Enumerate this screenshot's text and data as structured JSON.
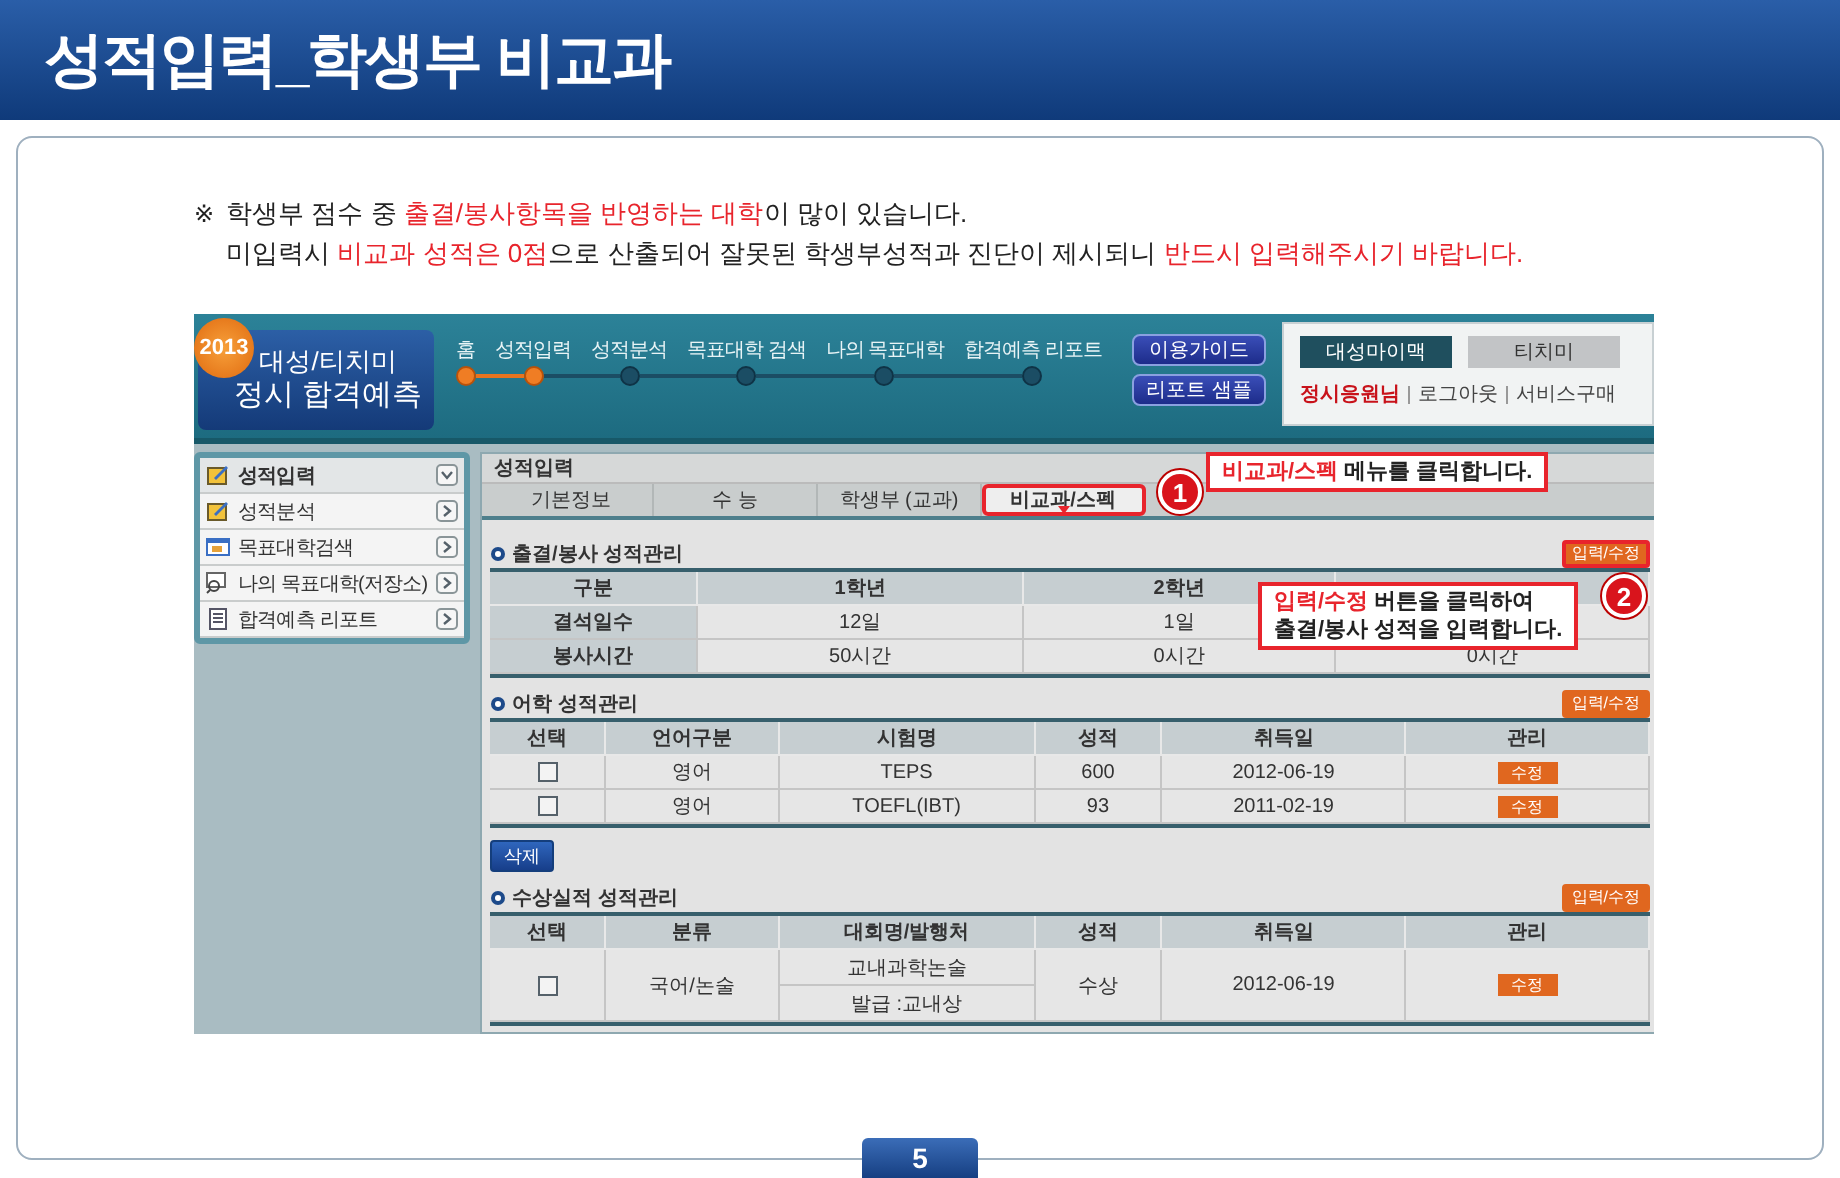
{
  "header": {
    "title": "성적입력_학생부 비교과"
  },
  "notice": {
    "mark": "※",
    "lines": [
      [
        {
          "text": "학생부 점수 중 ",
          "highlight": false
        },
        {
          "text": "출결/봉사항목을 반영하는 대학",
          "highlight": true
        },
        {
          "text": "이 많이 있습니다.",
          "highlight": false
        }
      ],
      [
        {
          "text": "미입력시 ",
          "highlight": false
        },
        {
          "text": "비교과 성적은 0점",
          "highlight": true
        },
        {
          "text": "으로 산출되어 잘못된 학생부성적과 진단이 제시되니 ",
          "highlight": false
        },
        {
          "text": "반드시 입력해주시기 바랍니다.",
          "highlight": true
        }
      ]
    ]
  },
  "app": {
    "logo": {
      "year": "2013",
      "line1": "대성/티치미",
      "line2": "정시 합격예측"
    },
    "steps": [
      {
        "label": "홈",
        "done": true
      },
      {
        "label": "성적입력",
        "done": true
      },
      {
        "label": "성적분석",
        "done": false
      },
      {
        "label": "목표대학 검색",
        "done": false
      },
      {
        "label": "나의 목표대학",
        "done": false
      },
      {
        "label": "합격예측 리포트",
        "done": false
      }
    ],
    "top_buttons": [
      "이용가이드",
      "리포트 샘플"
    ],
    "brand_tabs": [
      {
        "label": "대성마이맥",
        "selected": true
      },
      {
        "label": "티치미",
        "selected": false
      }
    ],
    "user_links": [
      {
        "label": "정시응원님",
        "kind": "user"
      },
      {
        "label": "로그아웃",
        "kind": "link"
      },
      {
        "label": "서비스구매",
        "kind": "link"
      }
    ],
    "sidebar": [
      {
        "label": "성적입력",
        "selected": true,
        "expanded": true
      },
      {
        "label": "성적분석",
        "selected": false,
        "expanded": false
      },
      {
        "label": "목표대학검색",
        "selected": false,
        "expanded": false
      },
      {
        "label": "나의 목표대학(저장소)",
        "selected": false,
        "expanded": false
      },
      {
        "label": "합격예측 리포트",
        "selected": false,
        "expanded": false
      }
    ],
    "page_title": "성적입력",
    "tabs": [
      {
        "label": "기본정보",
        "selected": false,
        "highlighted": false
      },
      {
        "label": "수 능",
        "selected": false,
        "highlighted": false
      },
      {
        "label": "학생부 (교과)",
        "selected": false,
        "highlighted": false
      },
      {
        "label": "비교과/스펙",
        "selected": true,
        "highlighted": true
      }
    ],
    "callouts": [
      {
        "number": "1",
        "lines": [
          [
            {
              "text": "비교과/스펙",
              "highlight": true
            },
            {
              "text": "  메뉴를 클릭합니다.",
              "highlight": false
            }
          ]
        ]
      },
      {
        "number": "2",
        "lines": [
          [
            {
              "text": "입력/수정",
              "highlight": true
            },
            {
              "text": " 버튼을 클릭하여",
              "highlight": false
            }
          ],
          [
            {
              "text": "출결/봉사 성적을 입력합니다.",
              "highlight": false
            }
          ]
        ]
      }
    ],
    "sections": [
      {
        "kind": "summary",
        "title": "출결/봉사 성적관리",
        "action": "입력/수정",
        "highlighted": true,
        "columns": [
          "구분",
          "1학년",
          "2학년"
        ],
        "rows": [
          {
            "cells": [
              "결석일수",
              "12일",
              "1일"
            ]
          },
          {
            "cells": [
              "봉사시간",
              "50시간",
              "0시간",
              "0시간"
            ]
          }
        ]
      },
      {
        "kind": "records",
        "title": "어학 성적관리",
        "action": "입력/수정",
        "highlighted": false,
        "columns": [
          "선택",
          "언어구분",
          "시험명",
          "성적",
          "취득일",
          "관리"
        ],
        "rows": [
          {
            "checked": false,
            "cells": [
              "",
              "영어",
              "TEPS",
              "600",
              "2012-06-19",
              "수정"
            ]
          },
          {
            "checked": false,
            "cells": [
              "",
              "영어",
              "TOEFL(IBT)",
              "93",
              "2011-02-19",
              "수정"
            ]
          }
        ],
        "footer_button": "삭제"
      },
      {
        "kind": "records",
        "title": "수상실적 성적관리",
        "action": "입력/수정",
        "highlighted": false,
        "columns": [
          "선택",
          "분류",
          "대회명/발행처",
          "성적",
          "취득일",
          "관리"
        ],
        "rows": [
          {
            "checked": false,
            "cells": [
              "",
              "국어/논술",
              [
                "교내과학논술",
                "발급 :교내상"
              ],
              "수상",
              "2012-06-19",
              "수정"
            ]
          }
        ]
      }
    ]
  },
  "page_number": "5"
}
